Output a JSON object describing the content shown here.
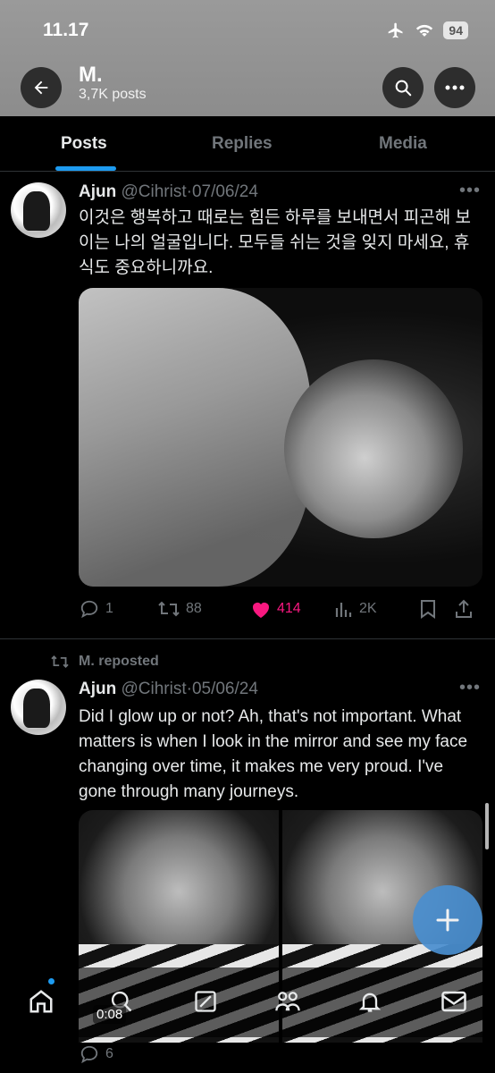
{
  "status": {
    "time": "11.17",
    "battery": "94"
  },
  "profile": {
    "name": "M.",
    "posts": "3,7K posts"
  },
  "tabs": [
    {
      "label": "Posts"
    },
    {
      "label": "Replies"
    },
    {
      "label": "Media"
    }
  ],
  "posts": [
    {
      "author": "Ajun",
      "handle": "@Cihrist",
      "date": "·07/06/24",
      "text": "이것은 행복하고 때로는 힘든 하루를 보내면서 피곤해 보이는 나의 얼굴입니다. 모두들 쉬는 것을 잊지 마세요, 휴식도 중요하니까요.",
      "replies": "1",
      "reposts": "88",
      "likes": "414",
      "views": "2K"
    },
    {
      "repost_label": "M. reposted",
      "author": "Ajun",
      "handle": "@Cihrist",
      "date": "·05/06/24",
      "text": "Did I glow up or not? Ah, that's not important. What matters is when I look in the mirror and see my face changing over time, it makes me very proud. I've gone through many journeys.",
      "replies": "6",
      "video_time": "0:08"
    }
  ],
  "colors": {
    "accent": "#1d9bf0",
    "like": "#f91880",
    "muted": "#71767b"
  }
}
